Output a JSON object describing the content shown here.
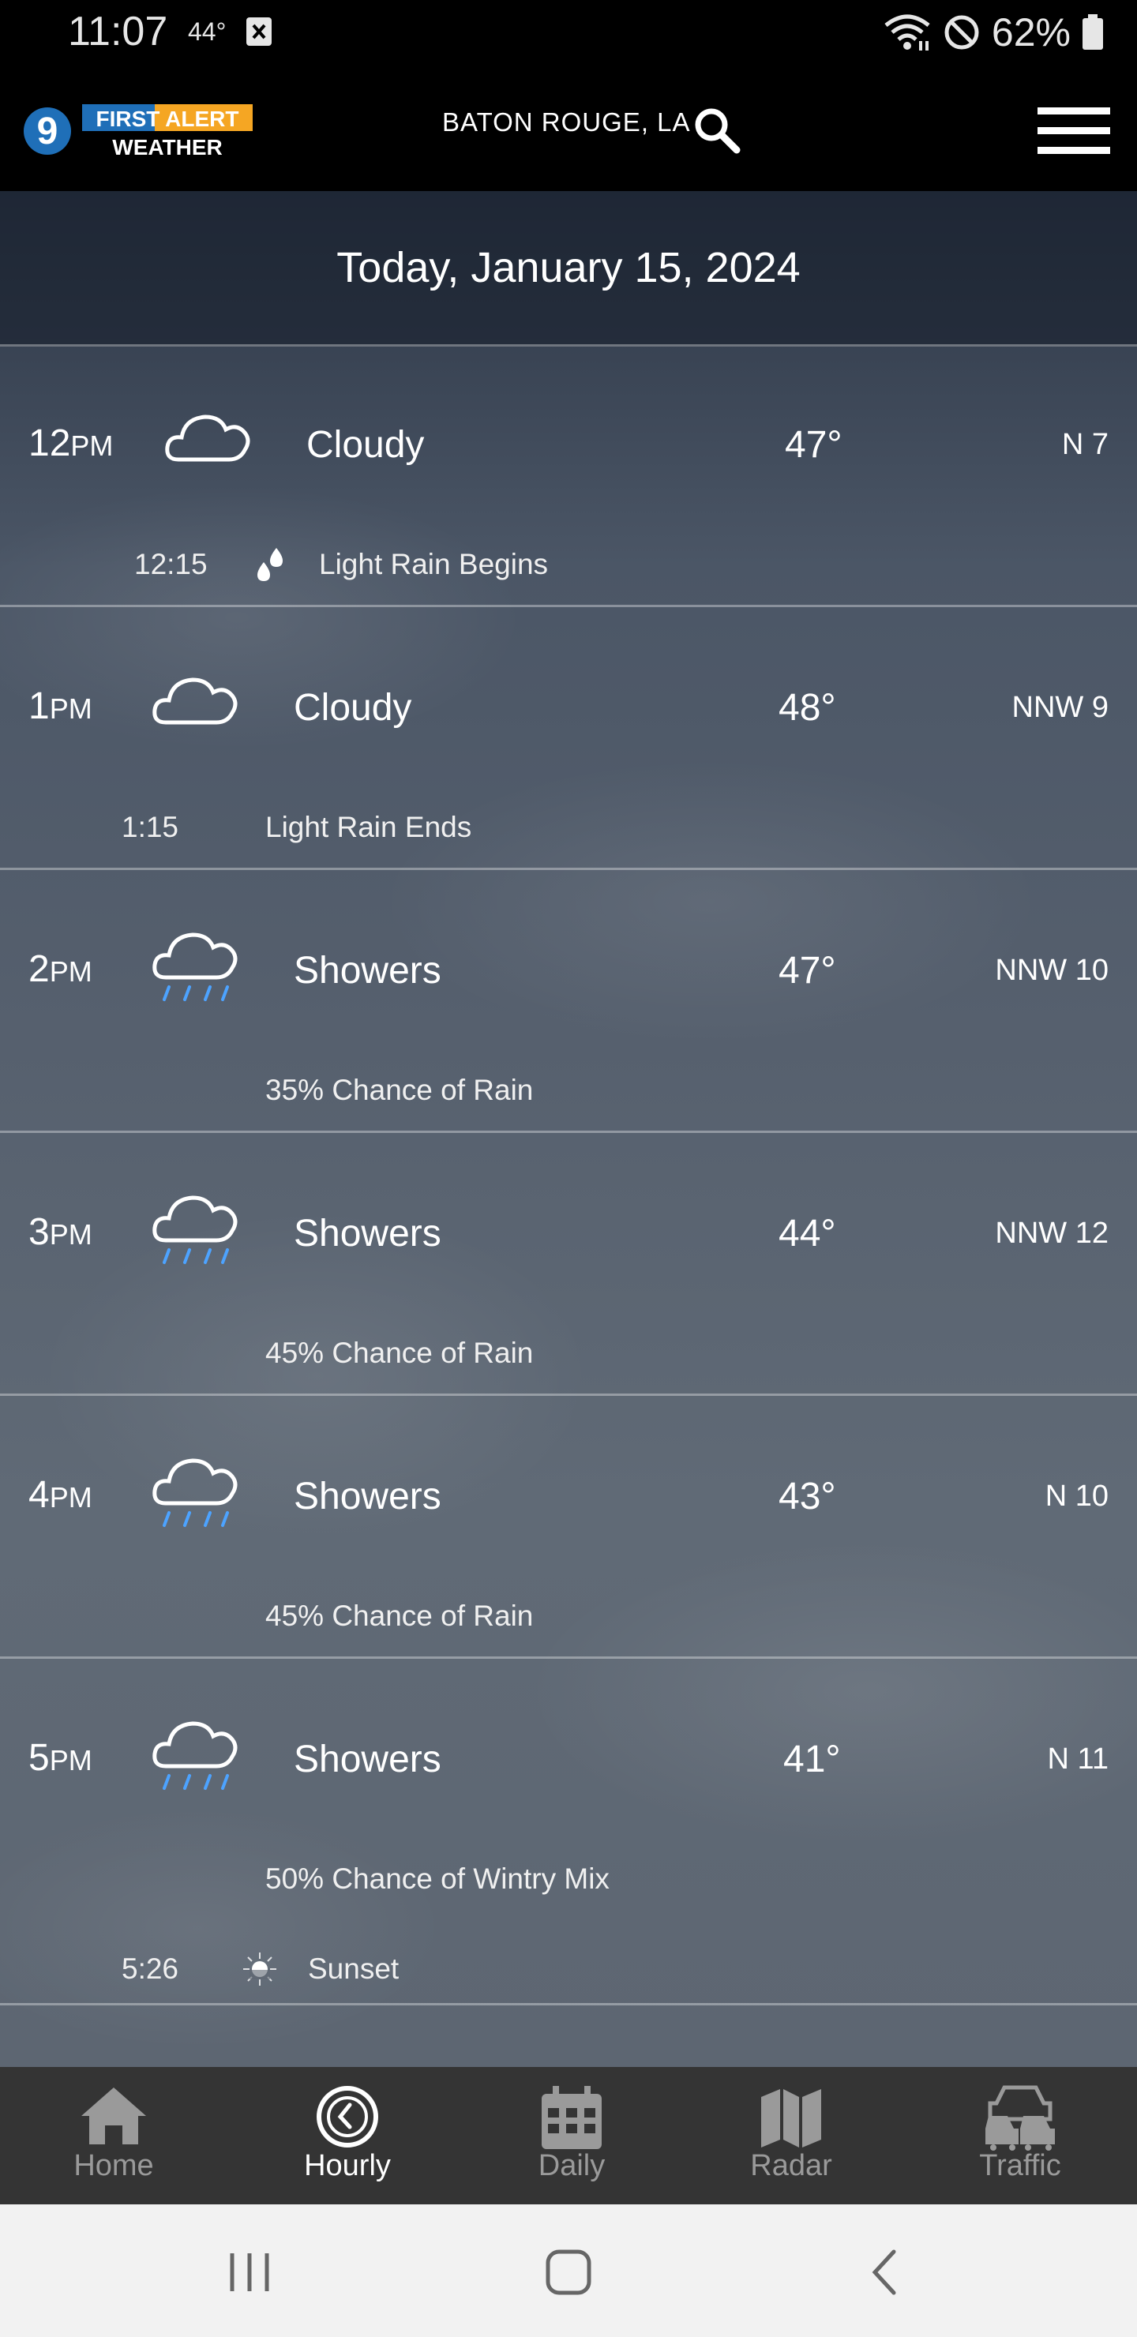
{
  "status_bar": {
    "time": "11:07",
    "temp": "44°",
    "battery": "62%"
  },
  "header": {
    "logo_number": "9",
    "logo_line1": "FIRST ALERT",
    "logo_line2": "WEATHER",
    "location": "BATON ROUGE, LA"
  },
  "date_title": "Today, January 15, 2024",
  "hours": [
    {
      "hour": "12",
      "ampm": "PM",
      "icon": "cloud-icon",
      "condition": "Cloudy",
      "temp": "47°",
      "wind": "N 7",
      "sub_time": "12:15",
      "sub_icon": "raindrops-icon",
      "sub_text": "Light Rain Begins"
    },
    {
      "hour": "1",
      "ampm": "PM",
      "icon": "cloud-icon",
      "condition": "Cloudy",
      "temp": "48°",
      "wind": "NNW 9",
      "sub_time": "1:15",
      "sub_text": "Light Rain Ends"
    },
    {
      "hour": "2",
      "ampm": "PM",
      "icon": "rain-cloud-icon",
      "condition": "Showers",
      "temp": "47°",
      "wind": "NNW 10",
      "sub_text": "35% Chance of Rain"
    },
    {
      "hour": "3",
      "ampm": "PM",
      "icon": "rain-cloud-icon",
      "condition": "Showers",
      "temp": "44°",
      "wind": "NNW 12",
      "sub_text": "45% Chance of Rain"
    },
    {
      "hour": "4",
      "ampm": "PM",
      "icon": "rain-cloud-icon",
      "condition": "Showers",
      "temp": "43°",
      "wind": "N 10",
      "sub_text": "45% Chance of Rain"
    },
    {
      "hour": "5",
      "ampm": "PM",
      "icon": "rain-cloud-icon",
      "condition": "Showers",
      "temp": "41°",
      "wind": "N 11",
      "sub_text": "50% Chance of Wintry Mix",
      "sub2_time": "5:26",
      "sub2_icon": "sunset-icon",
      "sub2_text": "Sunset"
    }
  ],
  "nav": {
    "home": "Home",
    "hourly": "Hourly",
    "daily": "Daily",
    "radar": "Radar",
    "traffic": "Traffic",
    "active": "Hourly"
  },
  "colors": {
    "logo_blue": "#1f6fb8",
    "logo_orange": "#f5a623",
    "rain_blue": "#4da3ff",
    "nav_bg": "#343434"
  }
}
